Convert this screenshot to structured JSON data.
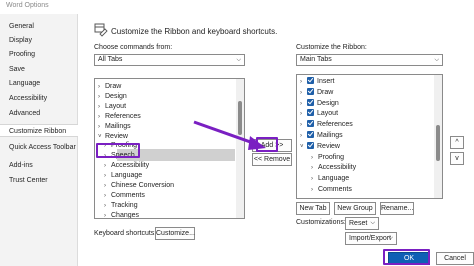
{
  "window": {
    "title": "Word Options"
  },
  "nav": [
    "General",
    "Display",
    "Proofing",
    "Save",
    "Language",
    "Accessibility",
    "Advanced",
    "Customize Ribbon",
    "Quick Access Toolbar",
    "Add-ins",
    "Trust Center"
  ],
  "nav_selected": "Customize Ribbon",
  "header": {
    "text": "Customize the Ribbon and keyboard shortcuts."
  },
  "left": {
    "label": "Choose commands from:",
    "dropdown_value": "All Tabs",
    "items": [
      {
        "label": "Draw",
        "caret": ">"
      },
      {
        "label": "Design",
        "caret": ">"
      },
      {
        "label": "Layout",
        "caret": ">"
      },
      {
        "label": "References",
        "caret": ">"
      },
      {
        "label": "Mailings",
        "caret": ">"
      },
      {
        "label": "Review",
        "caret": "v"
      },
      {
        "label": "Proofing",
        "caret": ">"
      },
      {
        "label": "Speech",
        "caret": ">"
      },
      {
        "label": "Accessibility",
        "caret": ">"
      },
      {
        "label": "Language",
        "caret": ">"
      },
      {
        "label": "Chinese Conversion",
        "caret": ">"
      },
      {
        "label": "Comments",
        "caret": ">"
      },
      {
        "label": "Tracking",
        "caret": ">"
      },
      {
        "label": "Changes",
        "caret": ">"
      }
    ]
  },
  "middle": {
    "add_label": "Add >>",
    "remove_label": "<< Remove"
  },
  "right": {
    "label": "Customize the Ribbon:",
    "dropdown_value": "Main Tabs",
    "items": [
      {
        "label": "Insert",
        "caret": ">",
        "checked": true
      },
      {
        "label": "Draw",
        "caret": ">",
        "checked": true
      },
      {
        "label": "Design",
        "caret": ">",
        "checked": true
      },
      {
        "label": "Layout",
        "caret": ">",
        "checked": true
      },
      {
        "label": "References",
        "caret": ">",
        "checked": true
      },
      {
        "label": "Mailings",
        "caret": ">",
        "checked": true
      },
      {
        "label": "Review",
        "caret": "v",
        "checked": true
      },
      {
        "label": "Proofing",
        "caret": ">",
        "checked": false
      },
      {
        "label": "Accessibility",
        "caret": ">",
        "checked": false
      },
      {
        "label": "Language",
        "caret": ">",
        "checked": false
      },
      {
        "label": "Comments",
        "caret": ">",
        "checked": false
      }
    ],
    "new_tab_label": "New Tab",
    "new_group_label": "New Group",
    "rename_label": "Rename...",
    "customizations_label": "Customizations:",
    "reset_label": "Reset",
    "import_export_label": "Import/Export",
    "move_up": "^",
    "move_down": "v"
  },
  "keyboard": {
    "label": "Keyboard shortcuts:",
    "customize_label": "Customize..."
  },
  "footer": {
    "ok_label": "OK",
    "cancel_label": "Cancel"
  },
  "annotation": {
    "color": "#7a1fc2"
  }
}
